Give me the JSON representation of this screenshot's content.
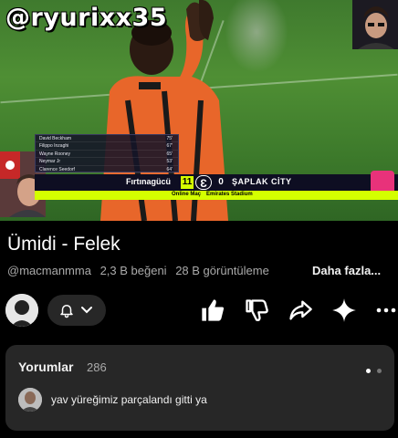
{
  "video": {
    "watermark": "@ryurixx35",
    "lineup": [
      {
        "name": "David Beckham",
        "rating": "75'"
      },
      {
        "name": "Filippo Inzaghi",
        "rating": "67'"
      },
      {
        "name": "Wayne Rooney",
        "rating": "65'"
      },
      {
        "name": "Neymar Jr",
        "rating": "53'"
      },
      {
        "name": "Clarence Seedorf",
        "rating": "64'"
      }
    ],
    "scoreboard": {
      "home_team": "Fırtınagücü",
      "home_score": "11",
      "away_score": "0",
      "away_team": "ŞAPLAK CİTY",
      "match_type": "Online Maç",
      "stadium": "Emirates Stadium"
    }
  },
  "info": {
    "title": "Ümidi - Felek",
    "channel": "@macmanmma",
    "likes": "2,3 B beğeni",
    "views": "28 B görüntüleme",
    "more_label": "Daha fazla..."
  },
  "actions": {
    "icons": [
      "avatar",
      "bell-icon",
      "chevron-down-icon",
      "thumbs-up-icon",
      "thumbs-down-icon",
      "share-icon",
      "sparkle-icon",
      "more-icon"
    ]
  },
  "comments": {
    "title": "Yorumlar",
    "count": "286",
    "top_comment": "yav yüreğimiz parçalandı gitti ya"
  },
  "colors": {
    "background": "#000000",
    "panel": "#272727",
    "score_accent": "#d4ff00",
    "muted_text": "#aaaaaa"
  }
}
